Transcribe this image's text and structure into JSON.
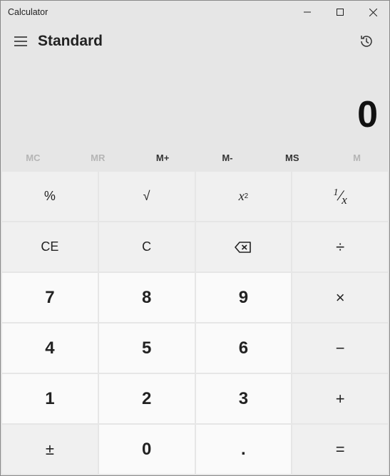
{
  "window": {
    "title": "Calculator"
  },
  "header": {
    "mode": "Standard"
  },
  "display": {
    "value": "0"
  },
  "memory": {
    "mc": "MC",
    "mr": "MR",
    "mplus": "M+",
    "mminus": "M-",
    "ms": "MS",
    "mlist": "M"
  },
  "keys": {
    "percent": "%",
    "sqrt": "√",
    "square_base": "x",
    "square_exp": "2",
    "recip_num": "1",
    "recip_den": "x",
    "ce": "CE",
    "c": "C",
    "divide": "÷",
    "multiply": "×",
    "minus": "−",
    "plus": "+",
    "equals": "=",
    "d7": "7",
    "d8": "8",
    "d9": "9",
    "d4": "4",
    "d5": "5",
    "d6": "6",
    "d1": "1",
    "d2": "2",
    "d3": "3",
    "d0": "0",
    "dot": ".",
    "sign": "±"
  }
}
